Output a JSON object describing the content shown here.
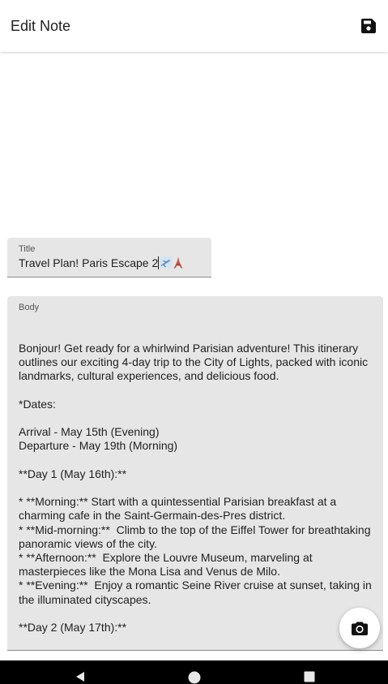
{
  "appbar": {
    "title": "Edit Note",
    "save_icon": "save-icon"
  },
  "title_field": {
    "label": "Title",
    "value": "Travel Plan! Paris Escape 2",
    "emoji": [
      "airplane-icon",
      "eiffel-tower-icon"
    ]
  },
  "body_field": {
    "label": "Body",
    "value": "Bonjour! Get ready for a whirlwind Parisian adventure! This itinerary outlines our exciting 4-day trip to the City of Lights, packed with iconic landmarks, cultural experiences, and delicious food.\n\n*Dates:\n\nArrival - May 15th (Evening)\nDeparture - May 19th (Morning)\n\n**Day 1 (May 16th):**\n\n* **Morning:** Start with a quintessential Parisian breakfast at a charming cafe in the Saint-Germain-des-Pres district.\n* **Mid-morning:**  Climb to the top of the Eiffel Tower for breathtaking panoramic views of the city.\n* **Afternoon:**  Explore the Louvre Museum, marveling at masterpieces like the Mona Lisa and Venus de Milo.\n* **Evening:**  Enjoy a romantic Seine River cruise at sunset, taking in the illuminated cityscapes.\n\n**Day 2 (May 17th):**"
  },
  "fab": {
    "icon": "camera-icon"
  },
  "navbar": {
    "icons": [
      "back-icon",
      "home-icon",
      "recents-icon"
    ]
  },
  "colors": {
    "field_bg": "#e6e6e6",
    "text": "#1f1f1f",
    "navbar": "#000000"
  }
}
